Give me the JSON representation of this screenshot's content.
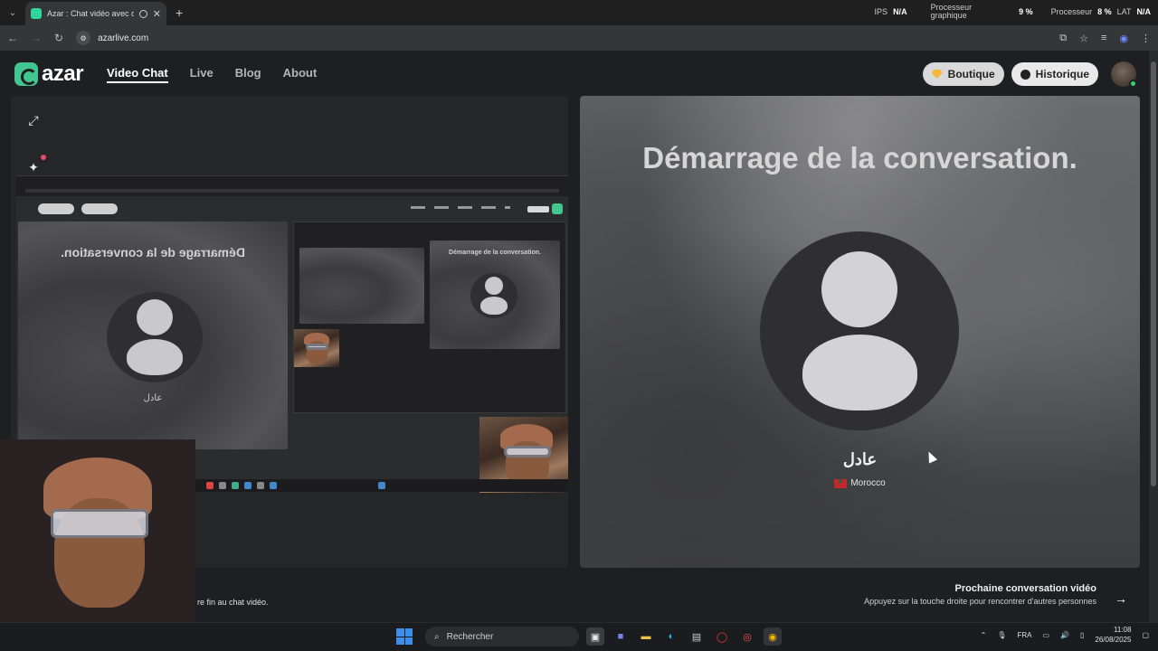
{
  "browser": {
    "tab_title": "Azar : Chat vidéo avec de n",
    "url": "azarlive.com",
    "perf": {
      "ips_label": "IPS",
      "ips_value": "N/A",
      "gpu_label_1": "Processeur",
      "gpu_label_2": "graphique",
      "gpu_value": "9 %",
      "cpu_label": "Processeur",
      "cpu_value": "8 %",
      "lat_label": "LAT",
      "lat_value": "N/A"
    }
  },
  "nav": {
    "logo_text": "azar",
    "links": [
      "Video Chat",
      "Live",
      "Blog",
      "About"
    ],
    "boutique_label": "Boutique",
    "historique_label": "Historique"
  },
  "mirror": {
    "title_flipped": "Démarrage de la conversation.",
    "name_flipped": "عادل",
    "inner_title": "Démarrage de la conversation."
  },
  "peer": {
    "status_title": "Démarrage de la conversation.",
    "name": "عادل",
    "country": "Morocco"
  },
  "bottom": {
    "left_text": "re fin au chat vidéo.",
    "next_title": "Prochaine conversation vidéo",
    "next_subtitle": "Appuyez sur la touche droite pour rencontrer d'autres personnes"
  },
  "taskbar": {
    "search_placeholder": "Rechercher",
    "language": "FRA",
    "time": "11:08",
    "date": "26/08/2025"
  },
  "colors": {
    "brand": "#42c58f",
    "accent_windows": "#3d8ee8"
  }
}
